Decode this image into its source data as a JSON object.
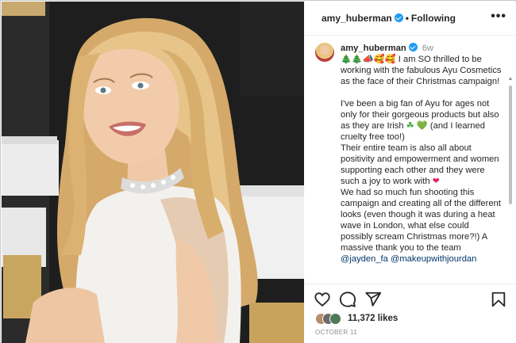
{
  "header": {
    "username": "amy_huberman",
    "separator": "•",
    "follow_label": "Following",
    "more_icon": "more-horizontal-icon",
    "more_label": "•••"
  },
  "caption": {
    "username": "amy_huberman",
    "time": "6w",
    "emojis": "🎄🎄📣🥰🥰",
    "line1": " I am SO thrilled to be working with the fabulous Ayu Cosmetics as the face of their Christmas campaign!",
    "para2_a": "I've been a big fan of Ayu for ages not only for their gorgeous products but also as they are Irish ",
    "para2_shamrock": "☘",
    "para2_heart": "💚",
    "para2_b": " (and I learned cruelty free too!)",
    "para3": "Their entire team is also all about positivity and empowerment and women supporting each other and they were such a joy to work with ",
    "para3_heart": "❤",
    "para4": "We had so much fun shooting this campaign and creating all of the different looks (even though it was during a heat wave in London, what else could possibly scream Christmas more?!) A massive thank you to the team ",
    "mention1": "@jayden_fa",
    "mention2": "@makeupwithjourdan"
  },
  "actions": {
    "like_icon": "heart-icon",
    "comment_icon": "comment-icon",
    "share_icon": "send-icon",
    "save_icon": "bookmark-icon",
    "likes_count": "11,372 likes",
    "date": "OCTOBER 11"
  },
  "colors": {
    "text": "#262626",
    "muted": "#8e8e8e",
    "verified": "#1d9bf0",
    "mention": "#00376b"
  }
}
